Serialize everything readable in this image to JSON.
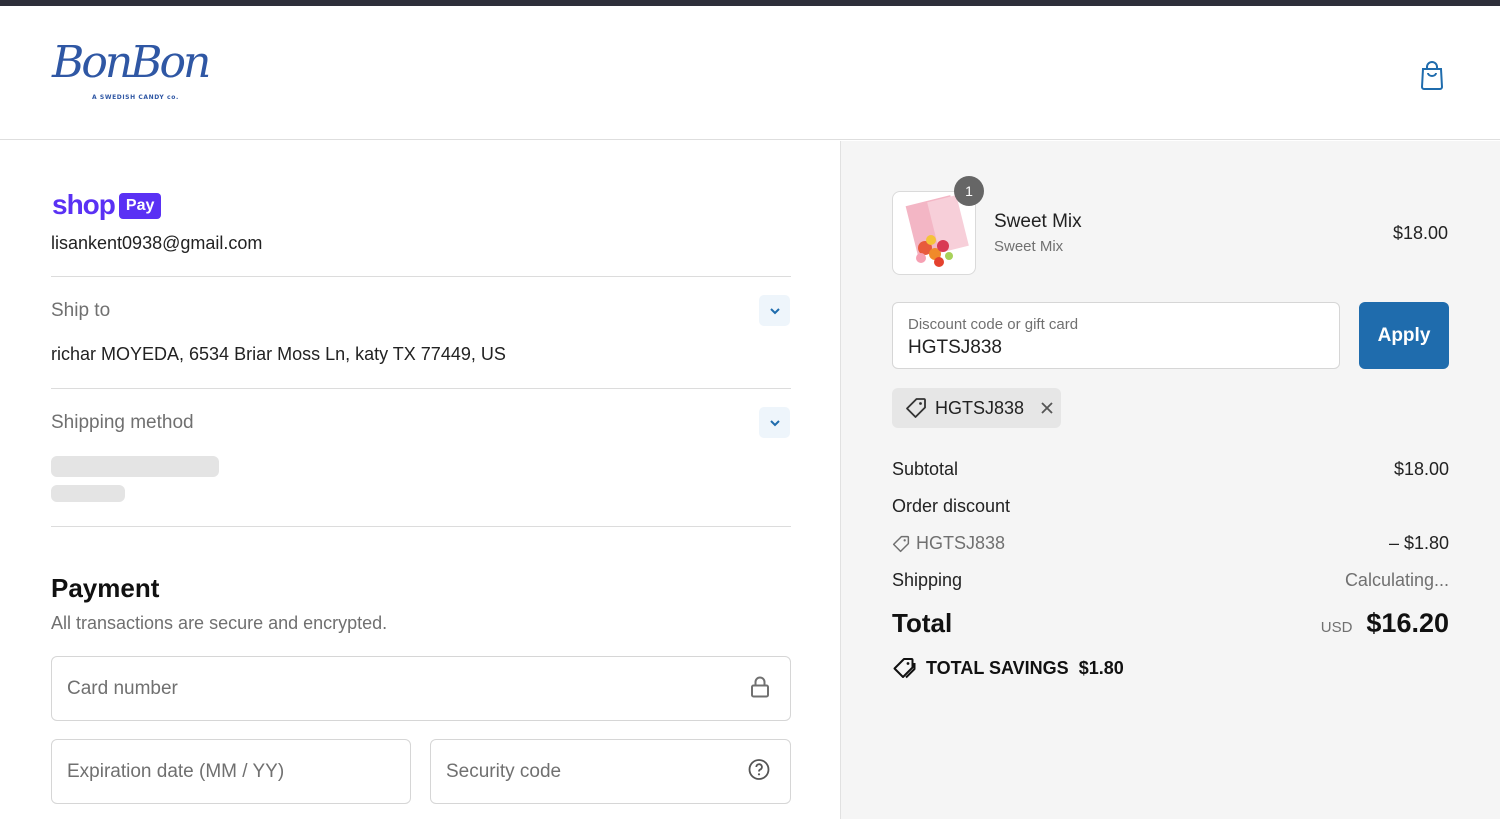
{
  "brand": {
    "logo_text": "BonBon",
    "logo_subtitle": "A SWEDISH CANDY co."
  },
  "header": {
    "cart_icon": "shopping-bag-icon"
  },
  "contact": {
    "shop_pay_word": "shop",
    "shop_pay_badge": "Pay",
    "email": "lisankent0938@gmail.com"
  },
  "ship_to": {
    "label": "Ship to",
    "address": "richar MOYEDA, 6534 Briar Moss Ln, katy TX 77449, US"
  },
  "shipping_method": {
    "label": "Shipping method"
  },
  "payment": {
    "title": "Payment",
    "subtitle": "All transactions are secure and encrypted.",
    "card_number_placeholder": "Card number",
    "expiration_placeholder": "Expiration date (MM / YY)",
    "security_code_placeholder": "Security code"
  },
  "order": {
    "item": {
      "quantity": "1",
      "name": "Sweet Mix",
      "variant": "Sweet Mix",
      "price": "$18.00"
    },
    "discount": {
      "label": "Discount code or gift card",
      "value": "HGTSJ838",
      "apply_label": "Apply",
      "applied_code": "HGTSJ838"
    },
    "summary": {
      "subtotal_label": "Subtotal",
      "subtotal_value": "$18.00",
      "order_discount_label": "Order discount",
      "discount_code": "HGTSJ838",
      "discount_value": "– $1.80",
      "shipping_label": "Shipping",
      "shipping_value": "Calculating...",
      "total_label": "Total",
      "total_currency": "USD",
      "total_value": "$16.20",
      "savings_label": "TOTAL SAVINGS",
      "savings_value": "$1.80"
    }
  },
  "colors": {
    "shop_pay_purple": "#5a31f4",
    "apply_blue": "#1f6cad",
    "brand_blue": "#2f57a4"
  }
}
